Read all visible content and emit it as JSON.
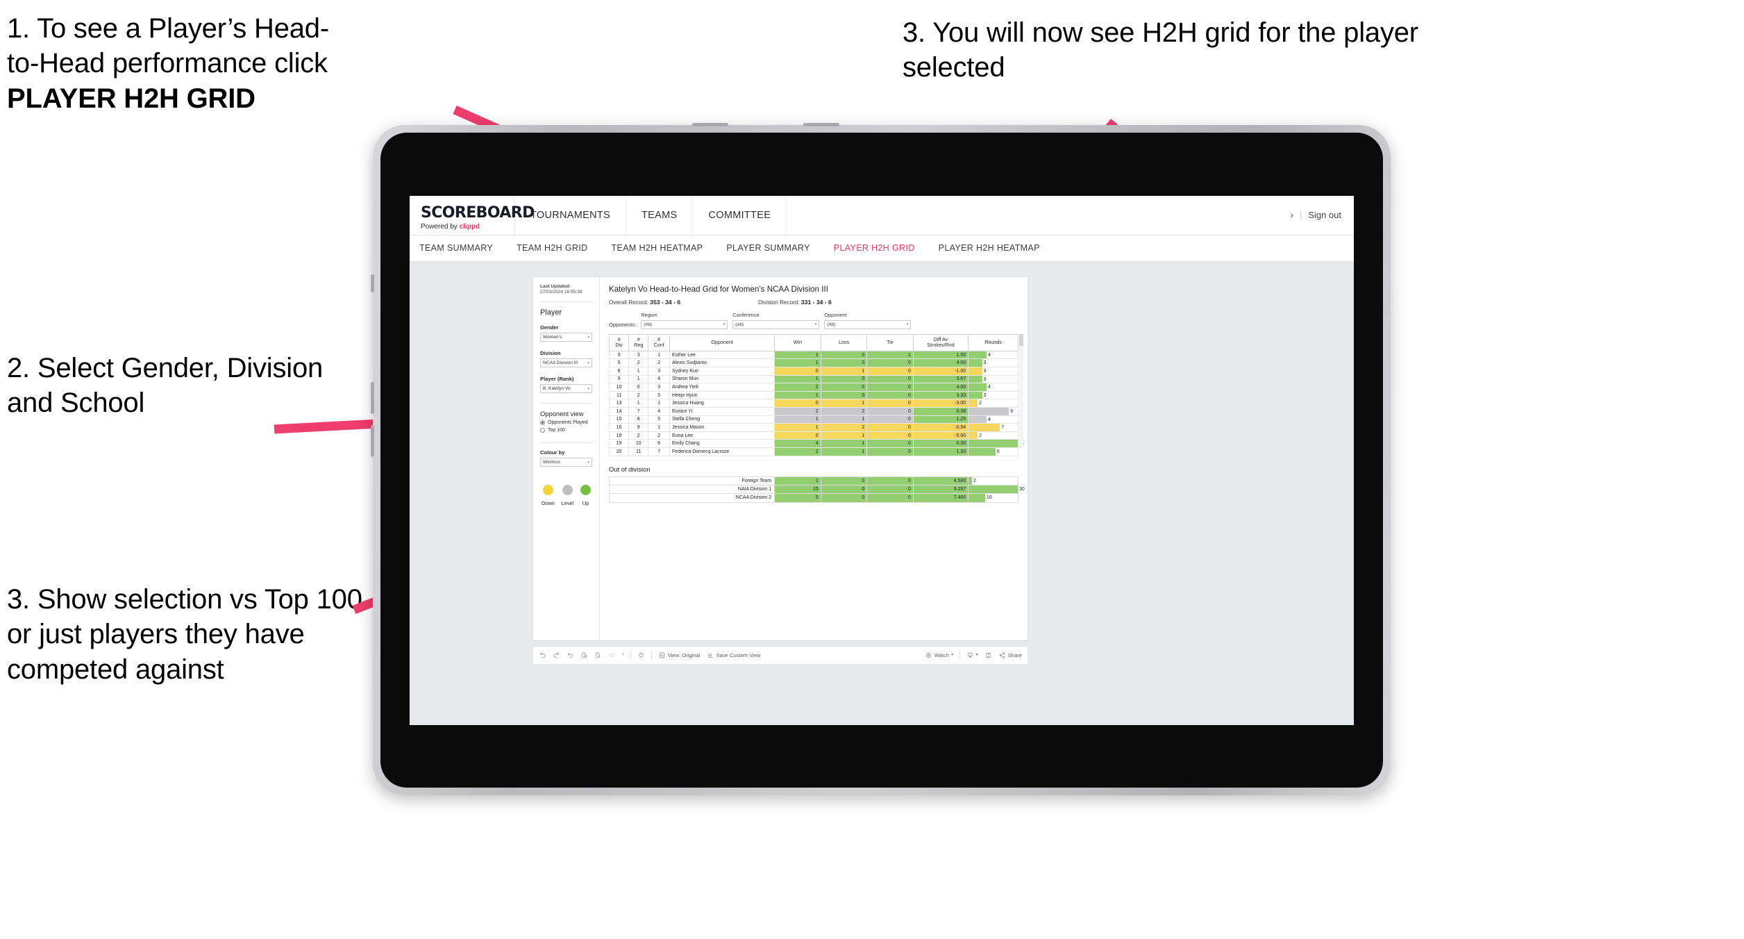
{
  "annotations": [
    {
      "id": "a1",
      "line1": "1. To see a Player’s Head-",
      "line2": "to-Head performance click",
      "bold": "PLAYER H2H GRID"
    },
    {
      "id": "a2",
      "text": "2. Select Gender, Division and School"
    },
    {
      "id": "a3",
      "text": "3. Show selection vs Top 100 or just players they have competed against"
    },
    {
      "id": "a4",
      "text": "3. You will now see H2H grid for the player selected"
    }
  ],
  "app": {
    "brand": {
      "name": "SCOREBOARD",
      "powered_prefix": "Powered by ",
      "powered_brand": "clippd"
    },
    "topnav": [
      "TOURNAMENTS",
      "TEAMS",
      "COMMITTEE"
    ],
    "top_right": {
      "chevron": "›",
      "separator": "|",
      "sign_out": "Sign out"
    },
    "subnav": [
      {
        "label": "TEAM SUMMARY",
        "active": false
      },
      {
        "label": "TEAM H2H GRID",
        "active": false
      },
      {
        "label": "TEAM H2H HEATMAP",
        "active": false
      },
      {
        "label": "PLAYER SUMMARY",
        "active": false
      },
      {
        "label": "PLAYER H2H GRID",
        "active": true
      },
      {
        "label": "PLAYER H2H HEATMAP",
        "active": false
      }
    ]
  },
  "sidebar": {
    "last_updated_label": "Last Updated:",
    "last_updated_value": "27/03/2024 16:55:38",
    "player_heading": "Player",
    "filters": [
      {
        "label": "Gender",
        "value": "Women's"
      },
      {
        "label": "Division",
        "value": "NCAA Division III"
      },
      {
        "label": "Player (Rank)",
        "value": "B. Katelyn Vo"
      }
    ],
    "opponent_view": {
      "heading": "Opponent view",
      "options": [
        {
          "label": "Opponents Played",
          "selected": true
        },
        {
          "label": "Top 100",
          "selected": false
        }
      ]
    },
    "colour_by": {
      "label": "Colour by",
      "value": "Win/loss"
    },
    "legend": [
      {
        "label": "Down",
        "color": "#F2D33C"
      },
      {
        "label": "Level",
        "color": "#BEBEC2"
      },
      {
        "label": "Up",
        "color": "#76C043"
      }
    ]
  },
  "main": {
    "title": "Katelyn Vo Head-to-Head Grid for Women’s NCAA Division III",
    "overall_record_label": "Overall Record:",
    "overall_record_value": "353 - 34 - 6",
    "division_record_label": "Division Record:",
    "division_record_value": "331 - 34 - 6",
    "opponents_label": "Opponents:",
    "filters": [
      {
        "label": "Region",
        "value": "(All)"
      },
      {
        "label": "Conference",
        "value": "(All)"
      },
      {
        "label": "Opponent",
        "value": "(All)"
      }
    ],
    "out_of_division_title": "Out of division"
  },
  "chart_data": {
    "type": "table",
    "title": "Katelyn Vo Head-to-Head Grid for Women’s NCAA Division III",
    "columns": [
      "# Div",
      "# Reg",
      "# Conf",
      "Opponent",
      "Win",
      "Loss",
      "Tie",
      "Diff Av Strokes/Rnd",
      "Rounds"
    ],
    "column_headers_multiline": [
      [
        "#",
        "Div"
      ],
      [
        "#",
        "Reg"
      ],
      [
        "#",
        "Conf"
      ],
      [
        "Opponent"
      ],
      [
        "Win"
      ],
      [
        "Loss"
      ],
      [
        "Tie"
      ],
      [
        "Diff Av",
        "Strokes/Rnd"
      ],
      [
        "Rounds"
      ]
    ],
    "rounds_max": 11,
    "rows": [
      {
        "div": "3",
        "reg": "3",
        "conf": "1",
        "opponent": "Esther Lee",
        "win": "1",
        "loss": "0",
        "tie": "1",
        "diff": "1.50",
        "rounds": "4",
        "color": "#93CE71"
      },
      {
        "div": "5",
        "reg": "2",
        "conf": "2",
        "opponent": "Alexis Sudjianto",
        "win": "1",
        "loss": "0",
        "tie": "0",
        "diff": "4.00",
        "rounds": "3",
        "color": "#93CE71"
      },
      {
        "div": "6",
        "reg": "1",
        "conf": "3",
        "opponent": "Sydney Kuo",
        "win": "0",
        "loss": "1",
        "tie": "0",
        "diff": "-1.00",
        "rounds": "3",
        "color": "#F5D75E"
      },
      {
        "div": "9",
        "reg": "1",
        "conf": "4",
        "opponent": "Sharon Mun",
        "win": "1",
        "loss": "0",
        "tie": "0",
        "diff": "3.67",
        "rounds": "3",
        "color": "#93CE71"
      },
      {
        "div": "10",
        "reg": "6",
        "conf": "3",
        "opponent": "Andrea York",
        "win": "2",
        "loss": "0",
        "tie": "0",
        "diff": "4.00",
        "rounds": "4",
        "color": "#93CE71"
      },
      {
        "div": "11",
        "reg": "2",
        "conf": "5",
        "opponent": "Heejo Hyun",
        "win": "1",
        "loss": "0",
        "tie": "0",
        "diff": "3.33",
        "rounds": "3",
        "color": "#93CE71"
      },
      {
        "div": "13",
        "reg": "1",
        "conf": "1",
        "opponent": "Jessica Huang",
        "win": "0",
        "loss": "1",
        "tie": "0",
        "diff": "-3.00",
        "rounds": "2",
        "color": "#F5D75E"
      },
      {
        "div": "14",
        "reg": "7",
        "conf": "4",
        "opponent": "Eunice Yi",
        "win": "2",
        "loss": "2",
        "tie": "0",
        "diff": "0.38",
        "rounds": "9",
        "color": "#C9C9CC",
        "diff_color": "#93CE71"
      },
      {
        "div": "15",
        "reg": "8",
        "conf": "5",
        "opponent": "Stella Cheng",
        "win": "1",
        "loss": "1",
        "tie": "0",
        "diff": "1.25",
        "rounds": "4",
        "color": "#C9C9CC",
        "diff_color": "#93CE71"
      },
      {
        "div": "16",
        "reg": "9",
        "conf": "1",
        "opponent": "Jessica Mason",
        "win": "1",
        "loss": "2",
        "tie": "0",
        "diff": "-0.94",
        "rounds": "7",
        "color": "#F5D75E"
      },
      {
        "div": "18",
        "reg": "2",
        "conf": "2",
        "opponent": "Euna Lee",
        "win": "0",
        "loss": "1",
        "tie": "0",
        "diff": "-5.00",
        "rounds": "2",
        "color": "#F5D75E"
      },
      {
        "div": "19",
        "reg": "10",
        "conf": "6",
        "opponent": "Emily Chang",
        "win": "4",
        "loss": "1",
        "tie": "0",
        "diff": "0.30",
        "rounds": "11",
        "color": "#93CE71"
      },
      {
        "div": "20",
        "reg": "11",
        "conf": "7",
        "opponent": "Federica Domecq Lacroze",
        "win": "2",
        "loss": "1",
        "tie": "0",
        "diff": "1.33",
        "rounds": "6",
        "color": "#93CE71"
      }
    ],
    "out_of_division": {
      "rounds_max": 30,
      "rows": [
        {
          "name": "Foreign Team",
          "win": "1",
          "loss": "0",
          "tie": "0",
          "diff": "4.500",
          "rounds": "2",
          "color": "#93CE71"
        },
        {
          "name": "NAIA Division 1",
          "win": "15",
          "loss": "0",
          "tie": "0",
          "diff": "9.267",
          "rounds": "30",
          "color": "#93CE71"
        },
        {
          "name": "NCAA Division 2",
          "win": "5",
          "loss": "0",
          "tie": "0",
          "diff": "7.400",
          "rounds": "10",
          "color": "#93CE71"
        }
      ]
    }
  },
  "toolbar": {
    "view_label": "View: Original",
    "save_label": "Save Custom View",
    "watch_label": "Watch",
    "share_label": "Share"
  },
  "colors": {
    "accent": "#e8335b",
    "up": "#93CE71",
    "down": "#F5D75E",
    "level": "#C9C9CC"
  }
}
